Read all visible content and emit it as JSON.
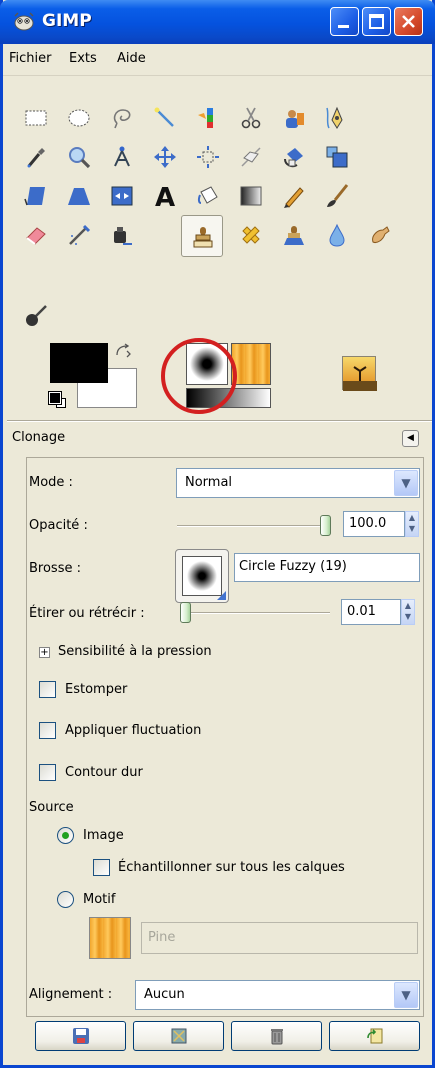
{
  "window": {
    "title": "GIMP"
  },
  "menu": [
    "Fichier",
    "Exts",
    "Aide"
  ],
  "toolbox": {
    "tools": [
      "rect-select",
      "ellipse-select",
      "free-select",
      "fuzzy-select",
      "color-select",
      "scissors",
      "foreground-select",
      "paths",
      "color-picker",
      "zoom",
      "measure",
      "move",
      "align",
      "crop",
      "rotate",
      "scale",
      "shear",
      "perspective",
      "flip",
      "text",
      "bucket-fill",
      "blend",
      "pencil",
      "paintbrush",
      "eraser",
      "airbrush",
      "ink",
      "clone",
      "heal",
      "perspective-clone",
      "blur",
      "smudge",
      "dodge-burn"
    ],
    "active_tool": "clone",
    "fg_color": "#000000",
    "bg_color": "#ffffff"
  },
  "dock": {
    "title": "Clonage"
  },
  "options": {
    "mode_label": "Mode :",
    "mode_value": "Normal",
    "opacity_label": "Opacité :",
    "opacity_value": "100.0",
    "opacity_fraction": 1.0,
    "brush_label": "Brosse :",
    "brush_name": "Circle Fuzzy (19)",
    "scale_label": "Étirer ou rétrécir :",
    "scale_value": "0.01",
    "pressure_label": "Sensibilité à la pression",
    "fade_label": "Estomper",
    "jitter_label": "Appliquer fluctuation",
    "hard_label": "Contour dur",
    "source_label": "Source",
    "image_label": "Image",
    "sample_label": "Échantillonner sur tous les calques",
    "pattern_label": "Motif",
    "pattern_name": "Pine",
    "align_label": "Alignement :",
    "align_value": "Aucun"
  },
  "state": {
    "source": "image",
    "fade": false,
    "jitter": false,
    "hard": false,
    "sample_merged": false
  }
}
